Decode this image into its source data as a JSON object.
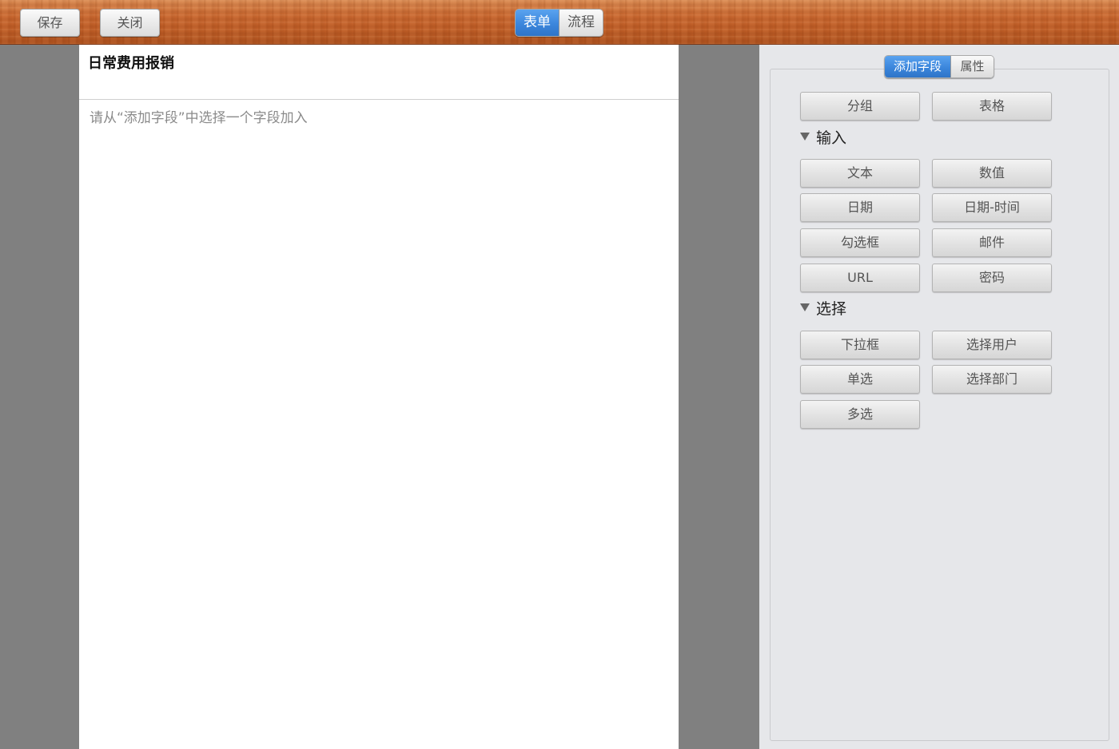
{
  "toolbar": {
    "save_label": "保存",
    "close_label": "关闭",
    "tabs": [
      {
        "label": "表单",
        "active": true
      },
      {
        "label": "流程",
        "active": false
      }
    ]
  },
  "form": {
    "title": "日常费用报销",
    "hint": "请从“添加字段”中选择一个字段加入"
  },
  "panel": {
    "tabs": [
      {
        "label": "添加字段",
        "active": true
      },
      {
        "label": "属性",
        "active": false
      }
    ],
    "top_buttons": [
      "分组",
      "表格"
    ],
    "sections": [
      {
        "label": "输入",
        "buttons": [
          "文本",
          "数值",
          "日期",
          "日期-时间",
          "勾选框",
          "邮件",
          "URL",
          "密码"
        ]
      },
      {
        "label": "选择",
        "buttons": [
          "下拉框",
          "选择用户",
          "单选",
          "选择部门",
          "多选"
        ]
      }
    ]
  },
  "colors": {
    "accent": "#3b86dc",
    "toolbar_wood": "#c9672f",
    "canvas_bg": "#808080",
    "panel_bg": "#e6e7ea"
  },
  "icons": {
    "section_toggle": "triangle-down-icon"
  }
}
